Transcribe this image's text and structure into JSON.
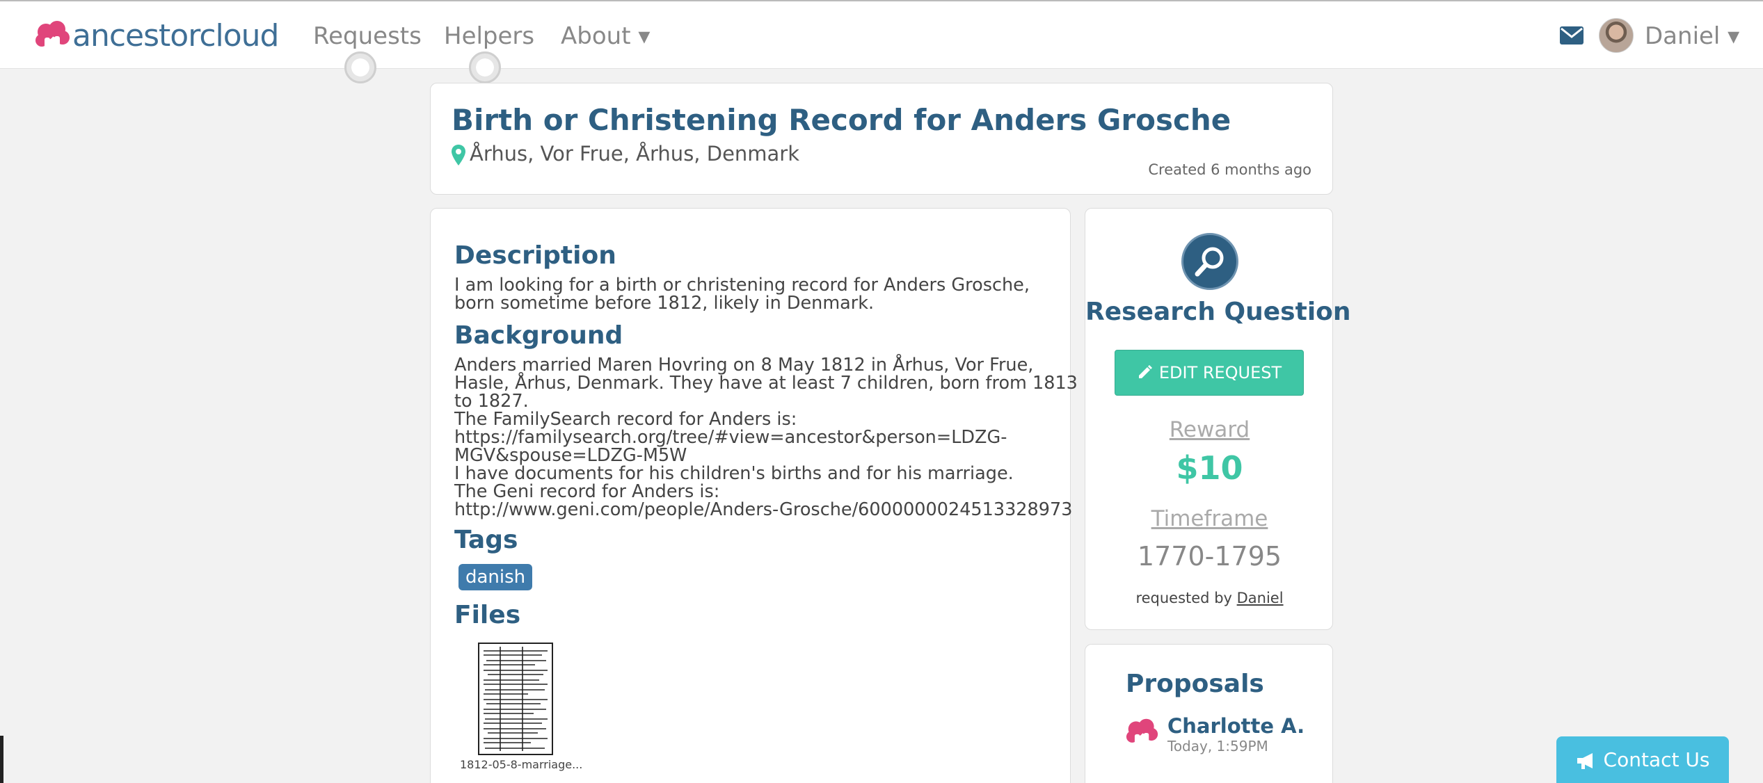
{
  "nav": {
    "logo_text": "ancestorcloud",
    "requests": "Requests",
    "helpers": "Helpers",
    "about": "About ▾",
    "user": "Daniel ▾"
  },
  "request": {
    "title": "Birth or Christening Record for Anders Grosche",
    "location": "Århus, Vor Frue, Århus, Denmark",
    "created": "Created 6 months ago"
  },
  "description": {
    "heading": "Description",
    "lines": [
      "I am looking for a birth or christening record for Anders Grosche,",
      "born sometime before 1812, likely in Denmark."
    ]
  },
  "background": {
    "heading": "Background",
    "lines": [
      "Anders married Maren Hovring on 8 May 1812 in Århus, Vor Frue,",
      "Hasle, Århus, Denmark. They have at least 7 children, born from 1813",
      "to 1827.",
      "The FamilySearch record for Anders is:",
      "https://familysearch.org/tree/#view=ancestor&person=LDZG-",
      "MGV&spouse=LDZG-M5W",
      "I have documents for his children's births and for his marriage.",
      "The Geni record for Anders is:",
      "http://www.geni.com/people/Anders-Grosche/6000000024513328973"
    ]
  },
  "tags": {
    "heading": "Tags",
    "items": [
      "danish"
    ]
  },
  "files": {
    "heading": "Files",
    "items": [
      {
        "name": "1812-05-8-marriage..."
      }
    ]
  },
  "sidebar": {
    "icon": "search-icon",
    "title": "Research Question",
    "edit_label": "EDIT REQUEST",
    "reward_label": "Reward",
    "reward_value": "$10",
    "timeframe_label": "Timeframe",
    "timeframe_value": "1770-1795",
    "requested_by_prefix": "requested by ",
    "requested_by_name": "Daniel"
  },
  "proposals": {
    "heading": "Proposals",
    "items": [
      {
        "name": "Charlotte A.",
        "time": "Today, 1:59PM"
      }
    ]
  },
  "contact": {
    "label": "Contact Us"
  },
  "colors": {
    "brand_blue": "#2e5f82",
    "accent_green": "#3fc6a5",
    "tag_blue": "#3f7bac",
    "logo_pink": "#e0457b",
    "contact_blue": "#49bfe0"
  }
}
